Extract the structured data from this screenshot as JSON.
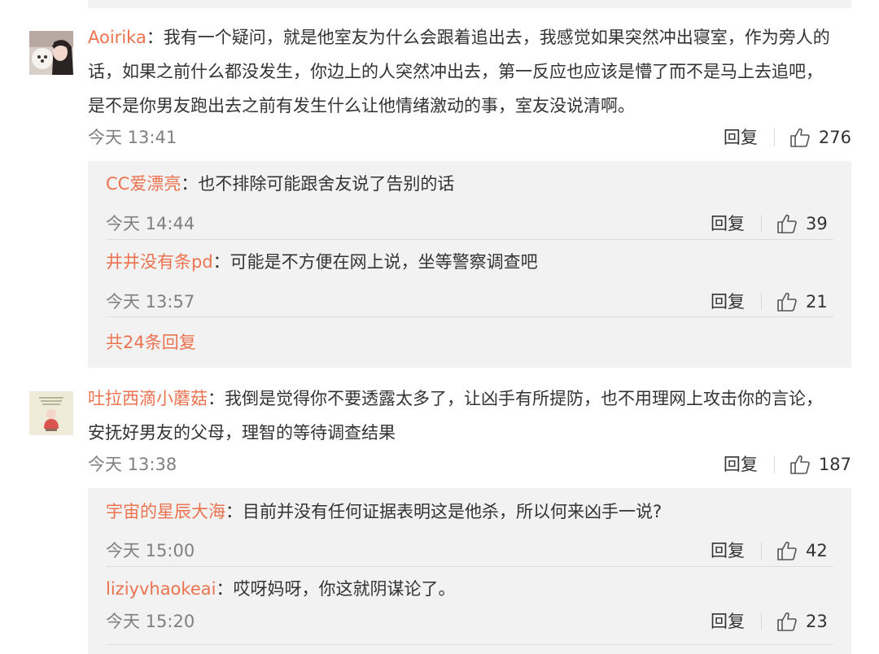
{
  "comments": [
    {
      "user": "Aoirika",
      "text": "：我有一个疑问，就是他室友为什么会跟着追出去，我感觉如果突然冲出寝室，作为旁人的话，如果之前什么都没发生，你边上的人突然冲出去，第一反应也应该是懵了而不是马上去追吧，是不是你男友跑出去之前有发生什么让他情绪激动的事，室友没说清啊。",
      "line1": "：我有一个疑问，就是他室友为什么会跟着追出去，我感觉如果突然冲出寝室，作为旁人的",
      "line2": "话，如果之前什么都没发生，你边上的人突然冲出去，第一反应也应该是懵了而不是马上去追吧，",
      "line3": "是不是你男友跑出去之前有发生什么让他情绪激动的事，室友没说清啊。",
      "time": "今天 13:41",
      "reply_label": "回复",
      "likes": "276",
      "replies": [
        {
          "user": "CC爱漂亮",
          "text": "：也不排除可能跟舍友说了告别的话",
          "time": "今天 14:44",
          "reply_label": "回复",
          "likes": "39"
        },
        {
          "user": "井井没有条pd",
          "text": "：可能是不方便在网上说，坐等警察调查吧",
          "time": "今天 13:57",
          "reply_label": "回复",
          "likes": "21"
        }
      ],
      "more_replies": "共24条回复"
    },
    {
      "user": "吐拉西滴小蘑菇",
      "line1": "：我倒是觉得你不要透露太多了，让凶手有所提防，也不用理网上攻击你的言论，",
      "line2": "安抚好男友的父母，理智的等待调查结果",
      "time": "今天 13:38",
      "reply_label": "回复",
      "likes": "187",
      "replies": [
        {
          "user": "宇宙的星辰大海",
          "text": "：目前并没有任何证据表明这是他杀，所以何来凶手一说?",
          "time": "今天 15:00",
          "reply_label": "回复",
          "likes": "42"
        },
        {
          "user": "liziyvhaokeai",
          "text": "：哎呀妈呀，你这就阴谋论了。",
          "time": "今天 15:20",
          "reply_label": "回复",
          "likes": "23"
        }
      ]
    }
  ],
  "colors": {
    "username": "#eb7350",
    "reply_bg": "#f2f2f2",
    "meta": "#808080"
  }
}
